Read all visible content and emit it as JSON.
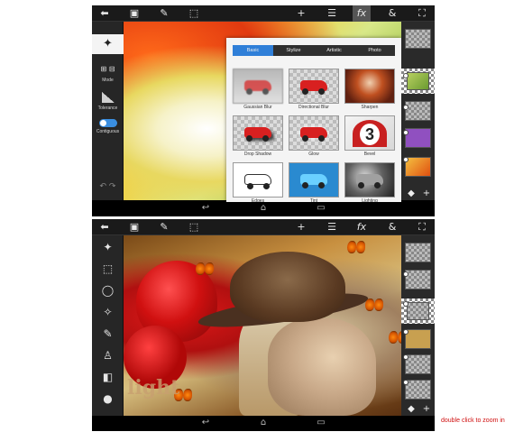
{
  "top_screen": {
    "toolbar": [
      {
        "name": "back-icon",
        "glyph": "⬅"
      },
      {
        "name": "image-add-icon",
        "glyph": "▣"
      },
      {
        "name": "brush-icon",
        "glyph": "✎"
      },
      {
        "name": "select-icon",
        "glyph": "⬚"
      },
      {
        "name": "add-icon",
        "glyph": "+"
      },
      {
        "name": "adjust-icon",
        "glyph": "☰"
      },
      {
        "name": "fx-icon",
        "glyph": "fx"
      },
      {
        "name": "blend-icon",
        "glyph": "&"
      },
      {
        "name": "fit-icon",
        "glyph": "⛶"
      }
    ],
    "left_tools": {
      "mode_label": "Mode",
      "tolerance_label": "Tolerance",
      "contiguous_label": "Contiguous"
    },
    "fx_tabs": [
      "Basic",
      "Stylize",
      "Artistic",
      "Photo"
    ],
    "fx_items": [
      "Gaussian Blur",
      "Directional Blur",
      "Sharpen",
      "Drop Shadow",
      "Glow",
      "Bevel",
      "Edges",
      "Tint",
      "Lighting"
    ],
    "bevel_number": "3"
  },
  "bottom_screen": {
    "scene_text": "light"
  },
  "caption": "double click to zoom in",
  "colors": {
    "accent": "#2f7fd8",
    "caption": "#d01010"
  }
}
